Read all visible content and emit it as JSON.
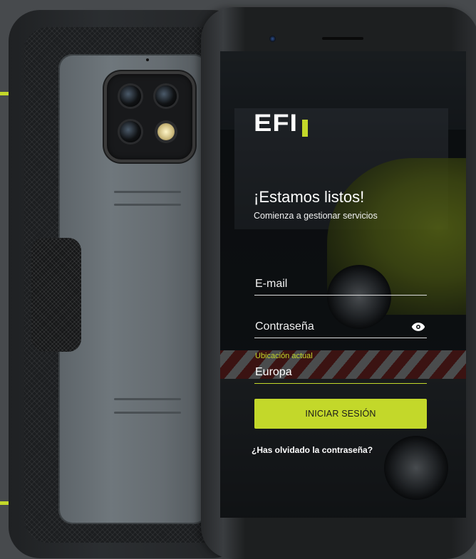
{
  "brand": {
    "logo_text": "EFI",
    "accent": "#c3d82a"
  },
  "login": {
    "heading": "¡Estamos listos!",
    "subheading": "Comienza a gestionar servicios",
    "email_placeholder": "E-mail",
    "password_placeholder": "Contraseña",
    "location_label": "Ubicación actual",
    "location_value": "Europa",
    "submit_label": "INICIAR SESIÓN",
    "forgot_label": "¿Has olvidado la contraseña?"
  },
  "icons": {
    "password_toggle": "eye-icon"
  }
}
